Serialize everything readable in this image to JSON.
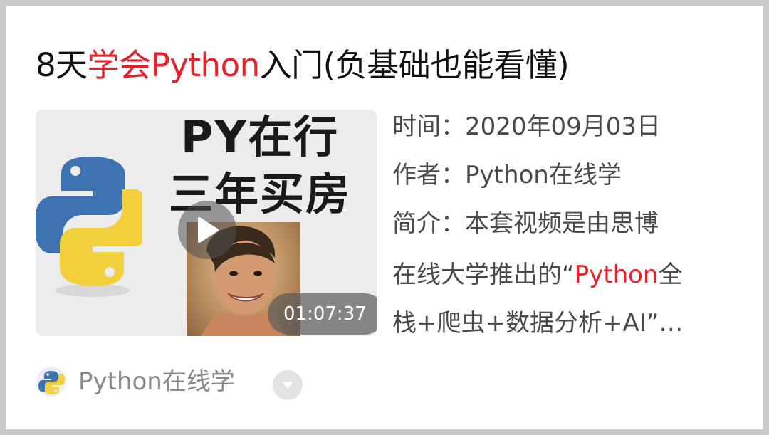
{
  "title": {
    "part1": "8天",
    "part2": "学会Python",
    "part3": "入门(负基础也能看懂)"
  },
  "thumbnail": {
    "line1": "PY在行",
    "line2": "三年买房",
    "duration": "01:07:37",
    "play_icon": "play-icon",
    "logo_icon": "python-logo-icon"
  },
  "meta": {
    "time_label": "时间：",
    "time_value": "2020年09月03日",
    "author_label": "作者：",
    "author_value": "Python在线学",
    "intro_label": "简介：",
    "intro_line1": "本套视频是由思博",
    "intro_line2_a": "在线大学推出的“",
    "intro_line2_b": "Python",
    "intro_line2_c": "全",
    "intro_line3": "栈+爬虫+数据分析+AI”…"
  },
  "footer": {
    "account_name": "Python在线学",
    "avatar_icon": "python-logo-icon",
    "chevron_icon": "chevron-down-icon"
  },
  "colors": {
    "accent": "#e8202a",
    "python_blue": "#3d73b0",
    "python_yellow": "#f2cf3d"
  }
}
